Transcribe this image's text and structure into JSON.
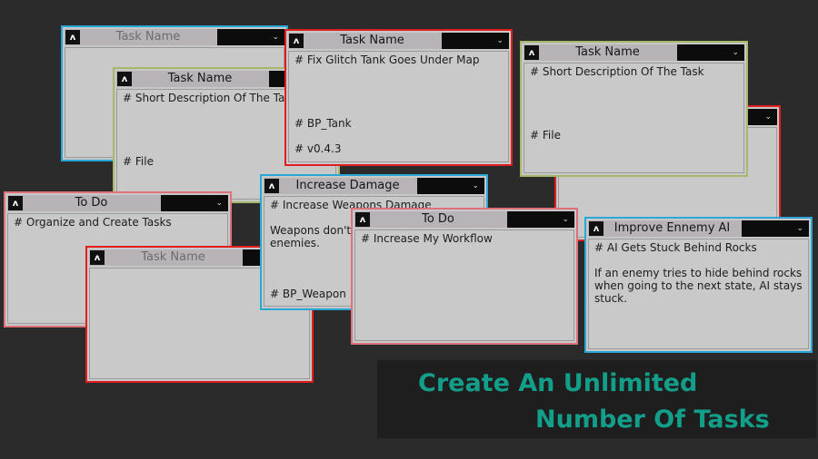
{
  "cards": {
    "c1": {
      "title": "Task Name",
      "dropdown": "⌄"
    },
    "c2": {
      "title": "Task Name",
      "dropdown": "⌄",
      "lines": [
        "# Short Description Of The Task",
        "",
        "",
        "",
        "",
        "# File"
      ]
    },
    "c3": {
      "title": "Task Name",
      "dropdown": "⌄",
      "lines": [
        "# Fix Glitch Tank Goes Under Map",
        "",
        "",
        "",
        "",
        "# BP_Tank",
        "",
        "# v0.4.3"
      ]
    },
    "c4": {
      "title": "Task Name",
      "dropdown": "⌄",
      "lines": [
        "# Short Description Of The Task",
        "",
        "",
        "",
        "",
        "# File"
      ]
    },
    "c5": {
      "title": "",
      "dropdown": "⌄"
    },
    "c6": {
      "title": "To Do",
      "dropdown": "⌄",
      "lines": [
        "# Organize and Create Tasks"
      ]
    },
    "c7": {
      "title": "Task Name",
      "dropdown": "⌄"
    },
    "c8": {
      "title": "Increase Damage",
      "dropdown": "⌄",
      "lines": [
        "# Increase Weapons Damage",
        "",
        "Weapons don't do enough damage to",
        "enemies.",
        "",
        "",
        "",
        "# BP_Weapon"
      ]
    },
    "c9": {
      "title": "To Do",
      "dropdown": "⌄",
      "lines": [
        "# Increase My Workflow"
      ]
    },
    "c10": {
      "title": "Improve Ennemy AI",
      "dropdown": "⌄",
      "lines": [
        "# AI Gets Stuck Behind Rocks",
        "",
        "If an enemy tries to hide behind rocks",
        "when going to the next state, AI stays",
        "stuck."
      ]
    }
  },
  "collapse_icon": "ʌ",
  "banner": {
    "line1": "Create An Unlimited",
    "line2": "Number Of Tasks",
    "color": "#139e8a"
  },
  "colors": {
    "blue": "#29a8d6",
    "red": "#e01e1e",
    "green": "#a6b86a",
    "pink": "#e0707a"
  }
}
